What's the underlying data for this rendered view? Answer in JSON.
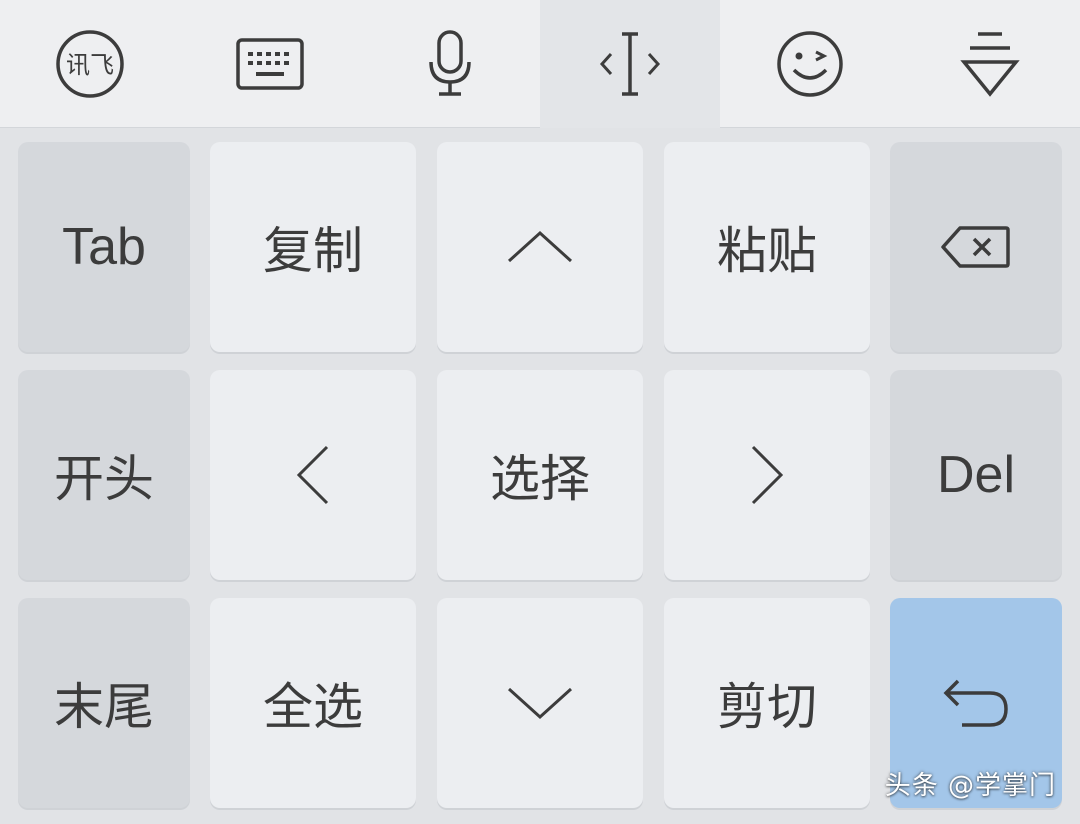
{
  "toolbar": {
    "logo_text": "讯飞",
    "items": [
      {
        "icon": "xunfei-logo-icon"
      },
      {
        "icon": "keyboard-icon"
      },
      {
        "icon": "microphone-icon"
      },
      {
        "icon": "cursor-edit-icon",
        "active": true
      },
      {
        "icon": "emoji-wink-icon"
      },
      {
        "icon": "hide-keyboard-icon"
      }
    ]
  },
  "keys": {
    "tab": "Tab",
    "copy": "复制",
    "up": {
      "icon": "arrow-up-icon"
    },
    "paste": "粘贴",
    "backspace": {
      "icon": "backspace-icon"
    },
    "home": "开头",
    "left": {
      "icon": "arrow-left-icon"
    },
    "select": "选择",
    "right": {
      "icon": "arrow-right-icon"
    },
    "del": "Del",
    "end": "末尾",
    "select_all": "全选",
    "down": {
      "icon": "arrow-down-icon"
    },
    "cut": "剪切",
    "enter": {
      "icon": "return-icon"
    }
  },
  "watermark": "头条 @学掌门",
  "colors": {
    "toolbar_bg": "#eeeff1",
    "key_bg": "#eceef1",
    "func_key_bg": "#d5d8dc",
    "enter_key_bg": "#a3c6e9",
    "icon_stroke": "#3c3c3c"
  }
}
